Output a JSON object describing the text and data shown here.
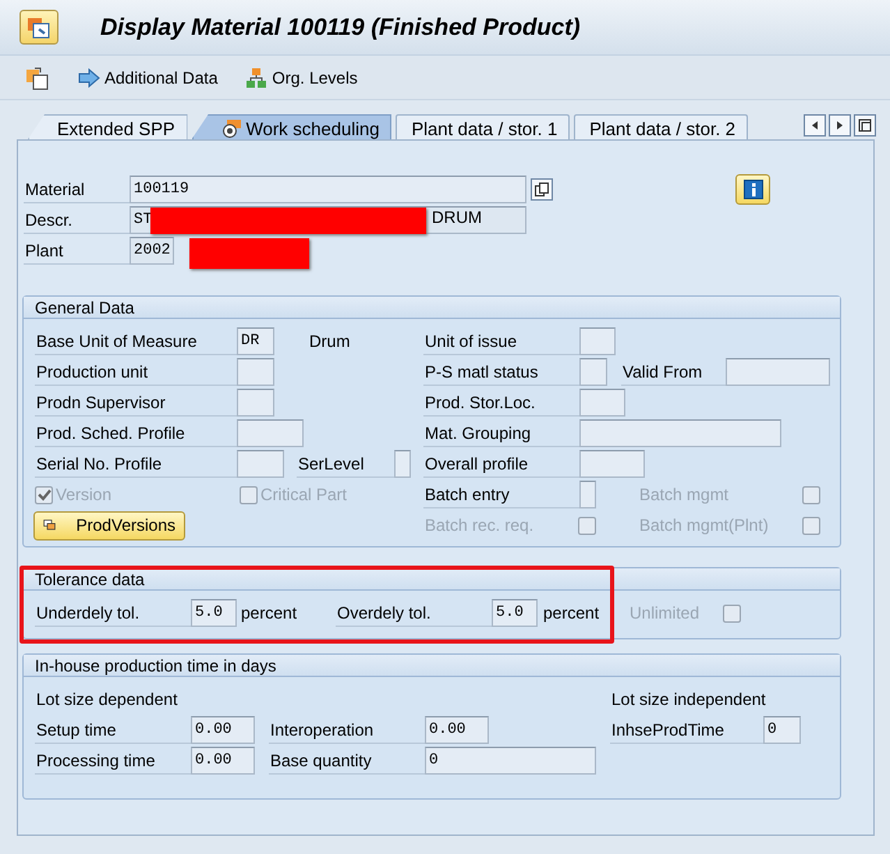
{
  "window": {
    "title": "Display Material 100119 (Finished Product)"
  },
  "toolbar": [
    {
      "kind": "new-doc"
    },
    {
      "kind": "arrow",
      "label": "Additional Data"
    },
    {
      "kind": "hierarchy",
      "label": "Org. Levels"
    }
  ],
  "tabs": [
    {
      "label": "Extended SPP",
      "selected": false
    },
    {
      "label": "Work scheduling",
      "selected": true
    },
    {
      "label": "Plant data / stor. 1",
      "selected": false
    },
    {
      "label": "Plant data / stor. 2",
      "selected": false
    }
  ],
  "header": {
    "material": {
      "label": "Material",
      "value": "100119"
    },
    "description": {
      "label": "Descr.",
      "value_start": "ST",
      "value_end": "DRUM"
    },
    "plant": {
      "label": "Plant",
      "value": "2002"
    }
  },
  "general_data": {
    "title": "General Data",
    "rows": [
      {
        "items": [
          {
            "kind": "field",
            "label": "Base Unit of Measure",
            "value": "DR"
          },
          {
            "kind": "text",
            "text": "Drum"
          },
          {
            "kind": "field",
            "label": "Unit of issue"
          }
        ]
      },
      {
        "items": [
          {
            "kind": "field",
            "label": "Production unit"
          },
          {
            "kind": "field",
            "label": "P-S matl status"
          },
          {
            "kind": "field",
            "label": "Valid From"
          }
        ]
      },
      {
        "items": [
          {
            "kind": "field",
            "label": "Prodn Supervisor"
          },
          {
            "kind": "field",
            "label": "Prod. Stor.Loc."
          }
        ]
      },
      {
        "items": [
          {
            "kind": "field",
            "label": "Prod. Sched. Profile"
          },
          {
            "kind": "field",
            "label": "Mat. Grouping"
          }
        ]
      },
      {
        "items": [
          {
            "kind": "field",
            "label": "Serial No. Profile"
          },
          {
            "kind": "field",
            "label": "SerLevel"
          },
          {
            "kind": "field",
            "label": "Overall profile"
          }
        ]
      },
      {
        "items": [
          {
            "kind": "checkbox",
            "label": "Version",
            "checked": true,
            "disabled": true
          },
          {
            "kind": "checkbox",
            "label": "Critical Part",
            "checked": false,
            "disabled": true
          },
          {
            "kind": "field",
            "label": "Batch entry"
          },
          {
            "kind": "check_field",
            "label": "Batch mgmt",
            "checked": false,
            "disabled": true
          }
        ]
      },
      {
        "items": [
          {
            "kind": "button",
            "label": "ProdVersions"
          },
          {
            "kind": "check_field",
            "label": "Batch rec. req.",
            "checked": false,
            "disabled": true
          },
          {
            "kind": "check_field",
            "label": "Batch mgmt(Plnt)",
            "checked": false,
            "disabled": true
          }
        ]
      }
    ]
  },
  "tolerance_data": {
    "title": "Tolerance data",
    "rows": [
      {
        "items": [
          {
            "kind": "field",
            "label": "Underdely tol.",
            "value": "5.0"
          },
          {
            "kind": "text",
            "text": "percent"
          },
          {
            "kind": "field",
            "label": "Overdely tol.",
            "value": "5.0"
          },
          {
            "kind": "text",
            "text": "percent"
          },
          {
            "kind": "check_field",
            "label": "Unlimited",
            "checked": false,
            "disabled": true
          }
        ]
      }
    ]
  },
  "inhouse_production": {
    "title": "In-house production time in days",
    "rows": [
      {
        "items": [
          {
            "kind": "text",
            "text": "Lot size dependent"
          },
          {
            "kind": "text",
            "text": "Lot size independent"
          }
        ]
      },
      {
        "items": [
          {
            "kind": "field",
            "label": "Setup time",
            "value": "0.00"
          },
          {
            "kind": "field",
            "label": "Interoperation",
            "value": "0.00"
          },
          {
            "kind": "field",
            "label": "InhseProdTime",
            "value": "0"
          }
        ]
      },
      {
        "items": [
          {
            "kind": "field",
            "label": "Processing time",
            "value": "0.00"
          },
          {
            "kind": "field",
            "label": "Base quantity",
            "value": "0"
          }
        ]
      }
    ]
  }
}
